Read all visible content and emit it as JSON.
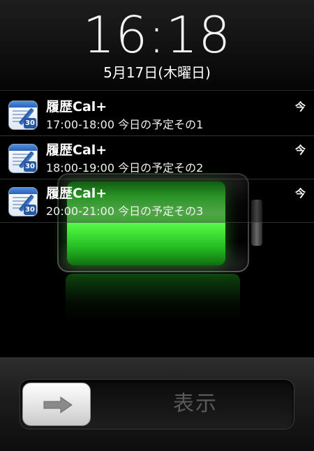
{
  "lockscreen": {
    "time": "16:18",
    "date": "5月17日(木曜日)"
  },
  "battery": {
    "charge_fraction": 0.92,
    "fill_color": "#41e53c"
  },
  "notifications": [
    {
      "app": "履歴Cal+",
      "icon": "calendar-app-icon",
      "icon_badge": "30",
      "message": "17:00-18:00 今日の予定その1",
      "time": "今"
    },
    {
      "app": "履歴Cal+",
      "icon": "calendar-app-icon",
      "icon_badge": "30",
      "message": "18:00-19:00 今日の予定その2",
      "time": "今"
    },
    {
      "app": "履歴Cal+",
      "icon": "calendar-app-icon",
      "icon_badge": "30",
      "message": "20:00-21:00 今日の予定その3",
      "time": "今"
    }
  ],
  "slider": {
    "label": "表示",
    "knob_icon": "arrow-right-icon"
  }
}
